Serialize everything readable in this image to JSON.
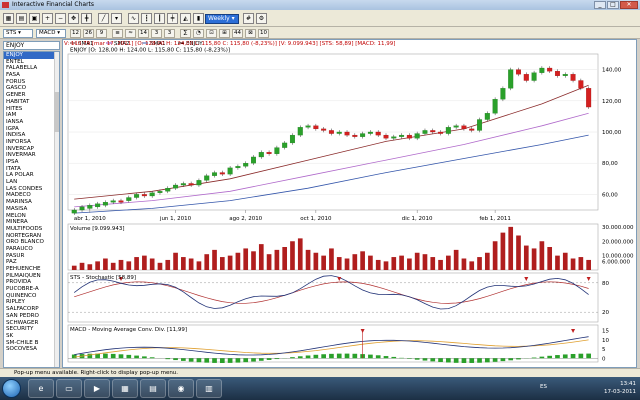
{
  "window": {
    "title": "Interactive Financial Charts",
    "buttons": [
      "_",
      "□",
      "✕"
    ]
  },
  "toolbar": {
    "period": "Weekly"
  },
  "toolbar2": {
    "studies": [
      "STS",
      "MACD"
    ],
    "params": [
      "12",
      "26",
      "9"
    ],
    "extra": [
      "14",
      "3",
      "3",
      "44",
      "10"
    ]
  },
  "sidebar": {
    "header": "ENJOY",
    "items": [
      "ENJOY",
      "ENTEL",
      "FALABELLA",
      "FASA",
      "FORUS",
      "GASCO",
      "GENER",
      "HABITAT",
      "HITES",
      "IAM",
      "IANSA",
      "IGPA",
      "INDISA",
      "INFORSA",
      "INVERCAP",
      "INVERMAR",
      "IPSA",
      "ITATA",
      "LA POLAR",
      "LAN",
      "LAS CONDES",
      "MADECO",
      "MARINSA",
      "MASISA",
      "MELON",
      "MINERA",
      "MULTIFOODS",
      "NORTEGRAN",
      "ORO BLANCO",
      "PARAUCO",
      "PASUR",
      "PAZ",
      "PEHUENCHE",
      "PILMAIQUEN",
      "PROVIDA",
      "PUCOBRE-A",
      "QUINENCO",
      "RIPLEY",
      "SALFACORP",
      "SAN PEDRO",
      "SCHWAGER",
      "SECURITY",
      "SK",
      "SM-CHILE B",
      "SOCOVESA"
    ],
    "active_index": 0
  },
  "chart": {
    "info": "V: 110,79 [mar 17, 2011] [O: 128,00  H: 124,00  L: 115,80  C: 115,80 (-8,23%)] [V: 9.099.943] [STS: 58,89] [MACD: 11,99]",
    "price_label": "ENJOY [O: 128,00  H: 124,00  L: 115,80  C: 115,80 (-8,23%)]",
    "legend": [
      "SMA1",
      "SMA2",
      "SMA1",
      "ENJOY"
    ],
    "legend_colors": [
      "#7d1a1a",
      "#9933aa",
      "#3355aa",
      "#000000"
    ],
    "price_axis": [
      "140,00",
      "120,00",
      "100,00",
      "80,00",
      "60,00"
    ],
    "date_axis": [
      "abr 1, 2010",
      "jun 1, 2010",
      "ago 2, 2010",
      "oct 1, 2010",
      "dic 1, 2010",
      "feb 1, 2011"
    ],
    "volume_label": "Volume [9.099.943]",
    "volume_axis": [
      "30.000.000",
      "20.000.000",
      "10.000.000",
      "6.000.000"
    ],
    "sts_label": "STS - Stochastic [58,89]",
    "sts_axis": [
      "80",
      "20"
    ],
    "macd_label": "MACD - Moving Average Conv. Div. [11,99]",
    "macd_axis": [
      "15",
      "10",
      "5",
      "0"
    ]
  },
  "chart_data": {
    "type": "candlestick",
    "title": "ENJOY",
    "ylim": [
      50,
      150
    ],
    "candles": [
      [
        48,
        50
      ],
      [
        50,
        52
      ],
      [
        51,
        53
      ],
      [
        52,
        54
      ],
      [
        53,
        55
      ],
      [
        55,
        56
      ],
      [
        56,
        55
      ],
      [
        56,
        58
      ],
      [
        58,
        60
      ],
      [
        60,
        59
      ],
      [
        59,
        61
      ],
      [
        61,
        62
      ],
      [
        62,
        64
      ],
      [
        64,
        66
      ],
      [
        66,
        67
      ],
      [
        67,
        66
      ],
      [
        66,
        69
      ],
      [
        69,
        72
      ],
      [
        72,
        74
      ],
      [
        74,
        73
      ],
      [
        73,
        77
      ],
      [
        77,
        78
      ],
      [
        78,
        80
      ],
      [
        80,
        84
      ],
      [
        84,
        87
      ],
      [
        87,
        86
      ],
      [
        86,
        90
      ],
      [
        90,
        93
      ],
      [
        93,
        98
      ],
      [
        98,
        103
      ],
      [
        103,
        104
      ],
      [
        104,
        102
      ],
      [
        102,
        101
      ],
      [
        101,
        99
      ],
      [
        99,
        100
      ],
      [
        100,
        98
      ],
      [
        98,
        97
      ],
      [
        97,
        99
      ],
      [
        99,
        100
      ],
      [
        100,
        98
      ],
      [
        98,
        96
      ],
      [
        96,
        97
      ],
      [
        97,
        98
      ],
      [
        98,
        96
      ],
      [
        96,
        99
      ],
      [
        99,
        101
      ],
      [
        101,
        100
      ],
      [
        100,
        99
      ],
      [
        99,
        103
      ],
      [
        103,
        104
      ],
      [
        104,
        102
      ],
      [
        102,
        101
      ],
      [
        101,
        108
      ],
      [
        108,
        112
      ],
      [
        112,
        121
      ],
      [
        121,
        128
      ],
      [
        128,
        140
      ],
      [
        140,
        137
      ],
      [
        137,
        133
      ],
      [
        133,
        138
      ],
      [
        138,
        141
      ],
      [
        141,
        139
      ],
      [
        139,
        136
      ],
      [
        136,
        137
      ],
      [
        137,
        133
      ],
      [
        133,
        128
      ],
      [
        128,
        116
      ]
    ],
    "volume": [
      3,
      5,
      4,
      6,
      8,
      5,
      7,
      6,
      9,
      10,
      8,
      5,
      7,
      12,
      9,
      8,
      6,
      11,
      14,
      9,
      10,
      12,
      15,
      13,
      18,
      11,
      14,
      16,
      20,
      22,
      14,
      12,
      10,
      15,
      9,
      8,
      11,
      13,
      10,
      7,
      6,
      9,
      10,
      8,
      12,
      11,
      9,
      7,
      10,
      14,
      8,
      6,
      9,
      12,
      20,
      26,
      30,
      24,
      17,
      15,
      20,
      16,
      10,
      12,
      8,
      9,
      7
    ],
    "sma_fast": [
      [
        0,
        57
      ],
      [
        10,
        62
      ],
      [
        20,
        70
      ],
      [
        30,
        82
      ],
      [
        40,
        94
      ],
      [
        50,
        102
      ],
      [
        60,
        118
      ],
      [
        66,
        130
      ]
    ],
    "sma_mid": [
      [
        0,
        52
      ],
      [
        10,
        56
      ],
      [
        20,
        62
      ],
      [
        30,
        72
      ],
      [
        40,
        82
      ],
      [
        50,
        92
      ],
      [
        60,
        104
      ],
      [
        66,
        112
      ]
    ],
    "sma_slow": [
      [
        0,
        48
      ],
      [
        10,
        51
      ],
      [
        20,
        56
      ],
      [
        30,
        64
      ],
      [
        40,
        74
      ],
      [
        50,
        83
      ],
      [
        60,
        92
      ],
      [
        66,
        98
      ]
    ]
  }
}
